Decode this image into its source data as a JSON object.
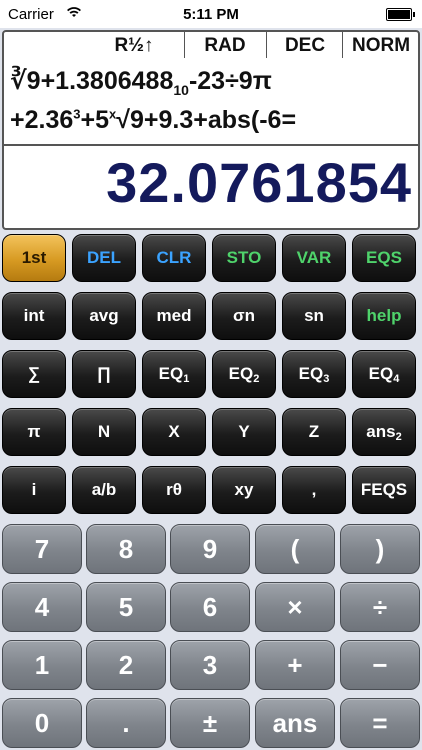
{
  "status": {
    "carrier": "Carrier",
    "time": "5:11 PM"
  },
  "display": {
    "modes": [
      "R½↑",
      "RAD",
      "DEC",
      "NORM"
    ],
    "expr_line1": [
      "∛9+1.3806488",
      "10",
      "-23÷9π"
    ],
    "expr_line2": [
      "+2.36",
      "3",
      "+5",
      "x",
      "√9+9.3+abs(-6="
    ],
    "result": "32.0761854"
  },
  "keys": {
    "row1": [
      "1st",
      "DEL",
      "CLR",
      "STO",
      "VAR",
      "EQS"
    ],
    "row2": [
      "int",
      "avg",
      "med",
      "σn",
      "sn",
      "help"
    ],
    "row3": [
      "∑",
      "∏",
      "EQ",
      "EQ",
      "EQ",
      "EQ"
    ],
    "row3_sub": [
      "",
      "",
      "1",
      "2",
      "3",
      "4"
    ],
    "row4": [
      "π",
      "N",
      "X",
      "Y",
      "Z",
      "ans"
    ],
    "row4_sub": [
      "",
      "",
      "",
      "",
      "",
      "2"
    ],
    "row5": [
      "i",
      "a/b",
      "rθ",
      "xy",
      ",",
      "FEQS"
    ]
  },
  "numpad": {
    "row1": [
      "7",
      "8",
      "9",
      "(",
      ")"
    ],
    "row2": [
      "4",
      "5",
      "6",
      "×",
      "÷"
    ],
    "row3": [
      "1",
      "2",
      "3",
      "+",
      "−"
    ],
    "row4": [
      "0",
      ".",
      "±",
      "ans",
      "="
    ]
  },
  "colors": {
    "gold_key": "#e2a834",
    "blue_label": "#3ba3ff",
    "green_label": "#4fd36b",
    "result_text": "#141a5c"
  }
}
